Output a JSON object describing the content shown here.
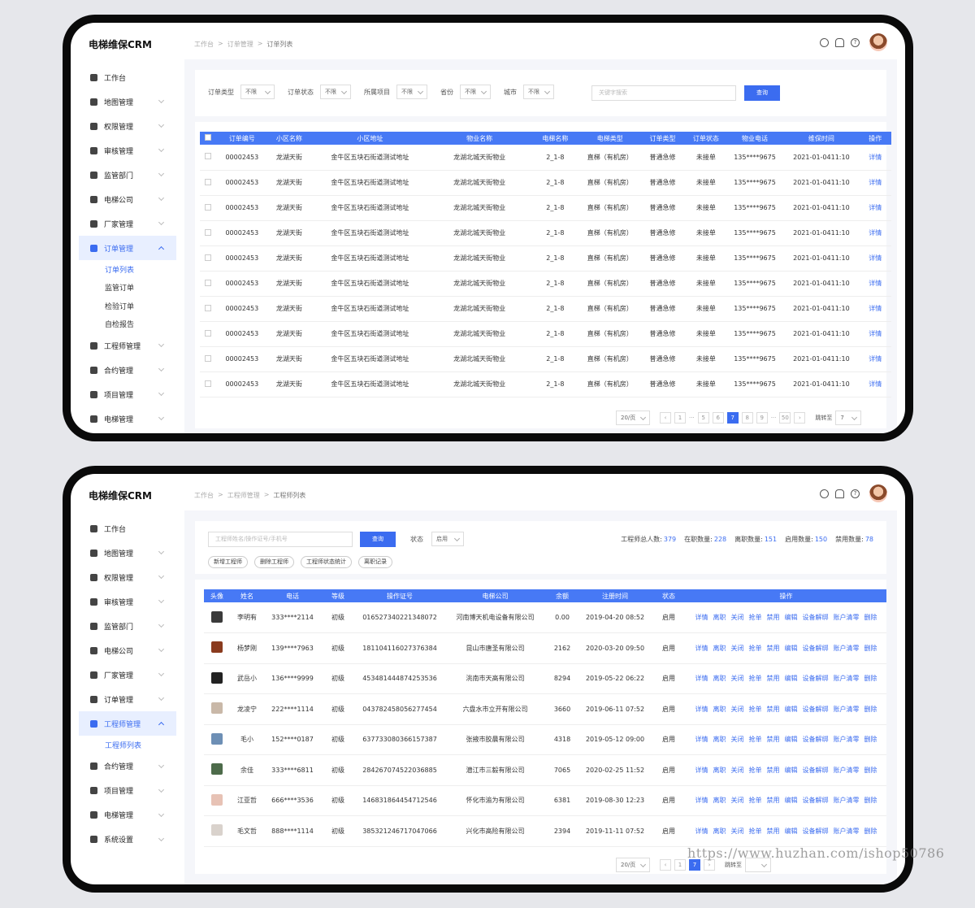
{
  "app": {
    "title": "电梯维保CRM"
  },
  "screen1": {
    "breadcrumb": [
      "工作台",
      "订单管理",
      "订单列表"
    ],
    "menu": [
      {
        "label": "工作台"
      },
      {
        "label": "地图管理"
      },
      {
        "label": "权限管理"
      },
      {
        "label": "审核管理"
      },
      {
        "label": "监管部门"
      },
      {
        "label": "电梯公司"
      },
      {
        "label": "厂家管理"
      },
      {
        "label": "订单管理",
        "active": true
      },
      {
        "label": "工程师管理"
      },
      {
        "label": "合约管理"
      },
      {
        "label": "项目管理"
      },
      {
        "label": "电梯管理"
      }
    ],
    "submenu": [
      "订单列表",
      "监管订单",
      "检验订单",
      "自检报告"
    ],
    "filters": [
      {
        "label": "订单类型",
        "value": "不限"
      },
      {
        "label": "订单状态",
        "value": "不限"
      },
      {
        "label": "所属项目",
        "value": "不限"
      },
      {
        "label": "省份",
        "value": "不限"
      },
      {
        "label": "城市",
        "value": "不限"
      }
    ],
    "search_placeholder": "关键字搜索",
    "search_btn": "查询",
    "columns": [
      "订单编号",
      "小区名称",
      "小区地址",
      "物业名称",
      "电梯名称",
      "电梯类型",
      "订单类型",
      "订单状态",
      "物业电话",
      "维保时间",
      "操作"
    ],
    "rows": [
      [
        "00002453",
        "龙湖天街",
        "金牛区五块石街道测试地址",
        "龙湖北城天街物业",
        "2_1-8",
        "直梯（有机房）",
        "普通急修",
        "未接单",
        "135****9675",
        "2021-01-0411:10",
        "详情"
      ],
      [
        "00002453",
        "龙湖天街",
        "金牛区五块石街道测试地址",
        "龙湖北城天街物业",
        "2_1-8",
        "直梯（有机房）",
        "普通急修",
        "未接单",
        "135****9675",
        "2021-01-0411:10",
        "详情"
      ],
      [
        "00002453",
        "龙湖天街",
        "金牛区五块石街道测试地址",
        "龙湖北城天街物业",
        "2_1-8",
        "直梯（有机房）",
        "普通急修",
        "未接单",
        "135****9675",
        "2021-01-0411:10",
        "详情"
      ],
      [
        "00002453",
        "龙湖天街",
        "金牛区五块石街道测试地址",
        "龙湖北城天街物业",
        "2_1-8",
        "直梯（有机房）",
        "普通急修",
        "未接单",
        "135****9675",
        "2021-01-0411:10",
        "详情"
      ],
      [
        "00002453",
        "龙湖天街",
        "金牛区五块石街道测试地址",
        "龙湖北城天街物业",
        "2_1-8",
        "直梯（有机房）",
        "普通急修",
        "未接单",
        "135****9675",
        "2021-01-0411:10",
        "详情"
      ],
      [
        "00002453",
        "龙湖天街",
        "金牛区五块石街道测试地址",
        "龙湖北城天街物业",
        "2_1-8",
        "直梯（有机房）",
        "普通急修",
        "未接单",
        "135****9675",
        "2021-01-0411:10",
        "详情"
      ],
      [
        "00002453",
        "龙湖天街",
        "金牛区五块石街道测试地址",
        "龙湖北城天街物业",
        "2_1-8",
        "直梯（有机房）",
        "普通急修",
        "未接单",
        "135****9675",
        "2021-01-0411:10",
        "详情"
      ],
      [
        "00002453",
        "龙湖天街",
        "金牛区五块石街道测试地址",
        "龙湖北城天街物业",
        "2_1-8",
        "直梯（有机房）",
        "普通急修",
        "未接单",
        "135****9675",
        "2021-01-0411:10",
        "详情"
      ],
      [
        "00002453",
        "龙湖天街",
        "金牛区五块石街道测试地址",
        "龙湖北城天街物业",
        "2_1-8",
        "直梯（有机房）",
        "普通急修",
        "未接单",
        "135****9675",
        "2021-01-0411:10",
        "详情"
      ],
      [
        "00002453",
        "龙湖天街",
        "金牛区五块石街道测试地址",
        "龙湖北城天街物业",
        "2_1-8",
        "直梯（有机房）",
        "普通急修",
        "未接单",
        "135****9675",
        "2021-01-0411:10",
        "详情"
      ]
    ],
    "pager": {
      "size": "20/页",
      "pages": [
        "1",
        "···",
        "5",
        "6",
        "7",
        "8",
        "9",
        "···",
        "50"
      ],
      "current": "7",
      "jump_label": "跳转至",
      "jump_value": "7"
    }
  },
  "screen2": {
    "breadcrumb": [
      "工作台",
      "工程师管理",
      "工程师列表"
    ],
    "menu": [
      {
        "label": "工作台"
      },
      {
        "label": "地图管理"
      },
      {
        "label": "权限管理"
      },
      {
        "label": "审核管理"
      },
      {
        "label": "监管部门"
      },
      {
        "label": "电梯公司"
      },
      {
        "label": "厂家管理"
      },
      {
        "label": "订单管理"
      },
      {
        "label": "工程师管理",
        "active": true
      },
      {
        "label": "合约管理"
      },
      {
        "label": "项目管理"
      },
      {
        "label": "电梯管理"
      },
      {
        "label": "系统设置"
      }
    ],
    "submenu": [
      "工程师列表"
    ],
    "search_placeholder": "工程师姓名/操作证号/手机号",
    "search_btn": "查询",
    "status_label": "状态",
    "status_value": "启用",
    "actions": [
      "新增工程师",
      "删除工程师",
      "工程师状态统计",
      "离职记录"
    ],
    "stats": [
      {
        "label": "工程师总人数:",
        "value": "379"
      },
      {
        "label": "在职数量:",
        "value": "228"
      },
      {
        "label": "离职数量:",
        "value": "151"
      },
      {
        "label": "启用数量:",
        "value": "150"
      },
      {
        "label": "禁用数量:",
        "value": "78"
      }
    ],
    "columns": [
      "头像",
      "姓名",
      "电话",
      "等级",
      "操作证号",
      "电梯公司",
      "余额",
      "注册时间",
      "状态",
      "操作"
    ],
    "ops": [
      "详情",
      "离职",
      "关闭",
      "抢单",
      "禁用",
      "编辑",
      "设备解绑",
      "账户清零",
      "删除"
    ],
    "rows": [
      {
        "face": "#3a3a3a",
        "name": "李明有",
        "phone": "333****2114",
        "level": "初级",
        "cert": "016527340221348072",
        "company": "河南博天机电设备有限公司",
        "balance": "0.00",
        "reg": "2019-04-20 08:52",
        "status": "启用"
      },
      {
        "face": "#8a3b1e",
        "name": "杨梦刚",
        "phone": "139****7963",
        "level": "初级",
        "cert": "181104116027376384",
        "company": "昆山市唐圣有限公司",
        "balance": "2162",
        "reg": "2020-03-20 09:50",
        "status": "启用"
      },
      {
        "face": "#222222",
        "name": "武岳小",
        "phone": "136****9999",
        "level": "初级",
        "cert": "453481444874253536",
        "company": "洮南市天高有限公司",
        "balance": "8294",
        "reg": "2019-05-22 06:22",
        "status": "启用"
      },
      {
        "face": "#c9b8a8",
        "name": "龙凌宁",
        "phone": "222****1114",
        "level": "初级",
        "cert": "043782458056277454",
        "company": "六盘水市立开有限公司",
        "balance": "3660",
        "reg": "2019-06-11 07:52",
        "status": "启用"
      },
      {
        "face": "#6d8fb5",
        "name": "毛小",
        "phone": "152****0187",
        "level": "初级",
        "cert": "637733080366157387",
        "company": "张掖市胶晨有限公司",
        "balance": "4318",
        "reg": "2019-05-12 09:00",
        "status": "启用"
      },
      {
        "face": "#4d6b4a",
        "name": "余佳",
        "phone": "333****6811",
        "level": "初级",
        "cert": "284267074522036885",
        "company": "潜江市三毅有限公司",
        "balance": "7065",
        "reg": "2020-02-25 11:52",
        "status": "启用"
      },
      {
        "face": "#e7c2b5",
        "name": "江亚哲",
        "phone": "666****3536",
        "level": "初级",
        "cert": "146831864454712546",
        "company": "怀化市渝为有限公司",
        "balance": "6381",
        "reg": "2019-08-30 12:23",
        "status": "启用"
      },
      {
        "face": "#d9d2cc",
        "name": "毛文哲",
        "phone": "888****1114",
        "level": "初级",
        "cert": "385321246717047066",
        "company": "兴化市高险有限公司",
        "balance": "2394",
        "reg": "2019-11-11 07:52",
        "status": "启用"
      }
    ],
    "pager": {
      "size": "20/页",
      "pages": [
        "1"
      ],
      "current": "7",
      "jump_label": "跳转至"
    }
  },
  "watermark": "https://www.huzhan.com/ishop50786"
}
